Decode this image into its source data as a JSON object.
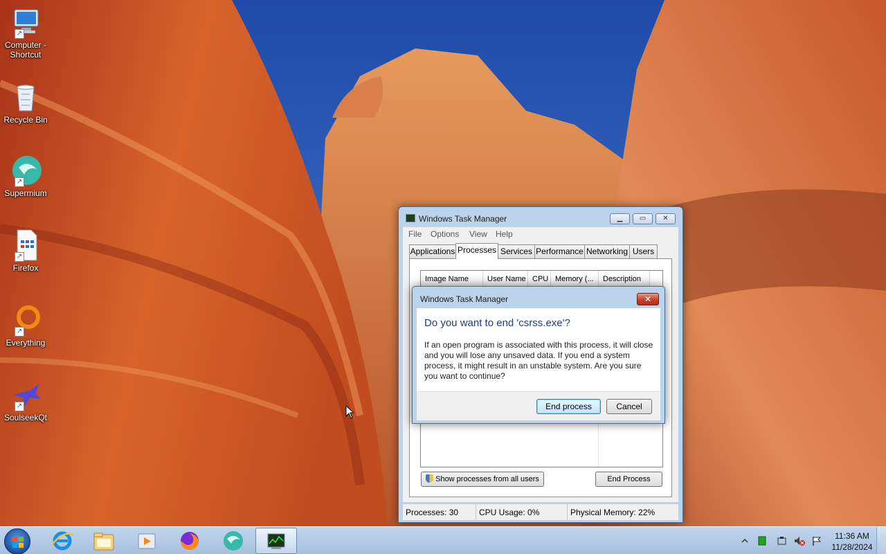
{
  "desktop": {
    "icons": [
      {
        "label": "Computer - Shortcut",
        "icon": "computer-icon"
      },
      {
        "label": "Recycle Bin",
        "icon": "recycle-bin-icon"
      },
      {
        "label": "Supermium",
        "icon": "supermium-icon"
      },
      {
        "label": "Firefox",
        "icon": "firefox-file-icon"
      },
      {
        "label": "Everything",
        "icon": "everything-icon"
      },
      {
        "label": "SoulseekQt",
        "icon": "soulseek-icon"
      }
    ]
  },
  "task_manager": {
    "title": "Windows Task Manager",
    "menu": [
      "File",
      "Options",
      "View",
      "Help"
    ],
    "tabs": [
      "Applications",
      "Processes",
      "Services",
      "Performance",
      "Networking",
      "Users"
    ],
    "active_tab": "Processes",
    "columns": [
      "Image Name",
      "User Name",
      "CPU",
      "Memory (...",
      "Description"
    ],
    "show_all_label": "Show processes from all users",
    "end_process_label": "End Process",
    "status": {
      "processes": "Processes: 30",
      "cpu": "CPU Usage: 0%",
      "memory": "Physical Memory: 22%"
    }
  },
  "dialog": {
    "title": "Windows Task Manager",
    "close_label": "✕",
    "heading": "Do you want to end 'csrss.exe'?",
    "message": "If an open program is associated with this process, it will close and you will lose any unsaved data. If you end a system process, it might result in an unstable system. Are you sure you want to continue?",
    "confirm_label": "End process",
    "cancel_label": "Cancel"
  },
  "taskbar": {
    "pinned": [
      "internet-explorer-icon",
      "file-explorer-icon",
      "media-player-icon",
      "firefox-icon",
      "supermium-icon",
      "task-manager-icon"
    ],
    "tray_icons": [
      "show-hidden-icons-icon",
      "network-icon",
      "power-icon",
      "volume-muted-icon",
      "action-center-flag-icon"
    ],
    "clock_time": "11:36 AM",
    "clock_date": "11/28/2024"
  },
  "colors": {
    "dialog_heading": "#1a3e8c",
    "close_button": "#c2422a",
    "taskbar": "#b4cbe6"
  }
}
